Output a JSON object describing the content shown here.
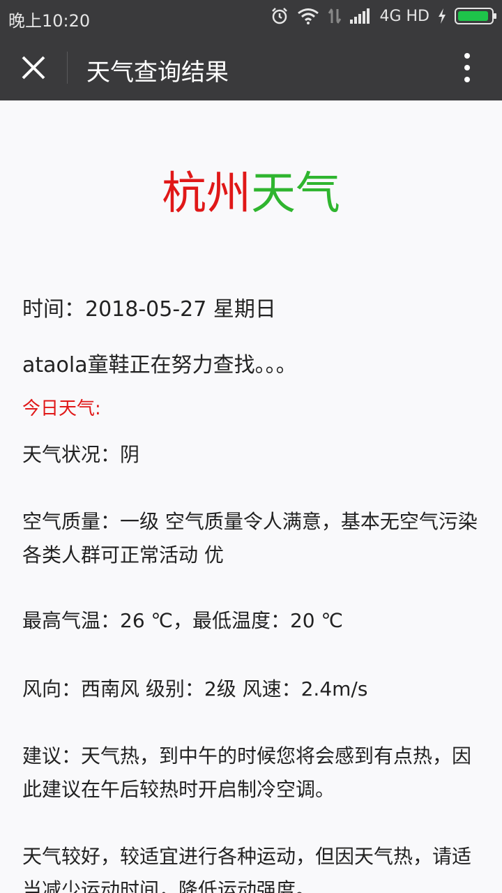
{
  "status_bar": {
    "time": "晚上10:20",
    "network": "4G HD"
  },
  "app_bar": {
    "title": "天气查询结果"
  },
  "heading": {
    "city": "杭州",
    "suffix": "天气"
  },
  "body": {
    "time_line": "时间：2018-05-27 星期日",
    "searching": "ataola童鞋正在努力查找。。。",
    "today_label": "今日天气:",
    "condition": "天气状况：阴",
    "air_quality": "空气质量：一级 空气质量令人满意，基本无空气污染 各类人群可正常活动 优",
    "temperature": "最高气温：26 ℃，最低温度：20 ℃",
    "wind": "风向：西南风 级别：2级 风速：2.4m/s",
    "suggestion": "建议：天气热，到中午的时候您将会感到有点热，因此建议在午后较热时开启制冷空调。",
    "sport": "天气较好，较适宜进行各种运动，但因天气热，请适当减少运动时间，降低运动强度。"
  },
  "colors": {
    "city": "#e01818",
    "weather": "#2fb52f",
    "bar": "#3a3a3c",
    "battery": "#1ec44a"
  }
}
